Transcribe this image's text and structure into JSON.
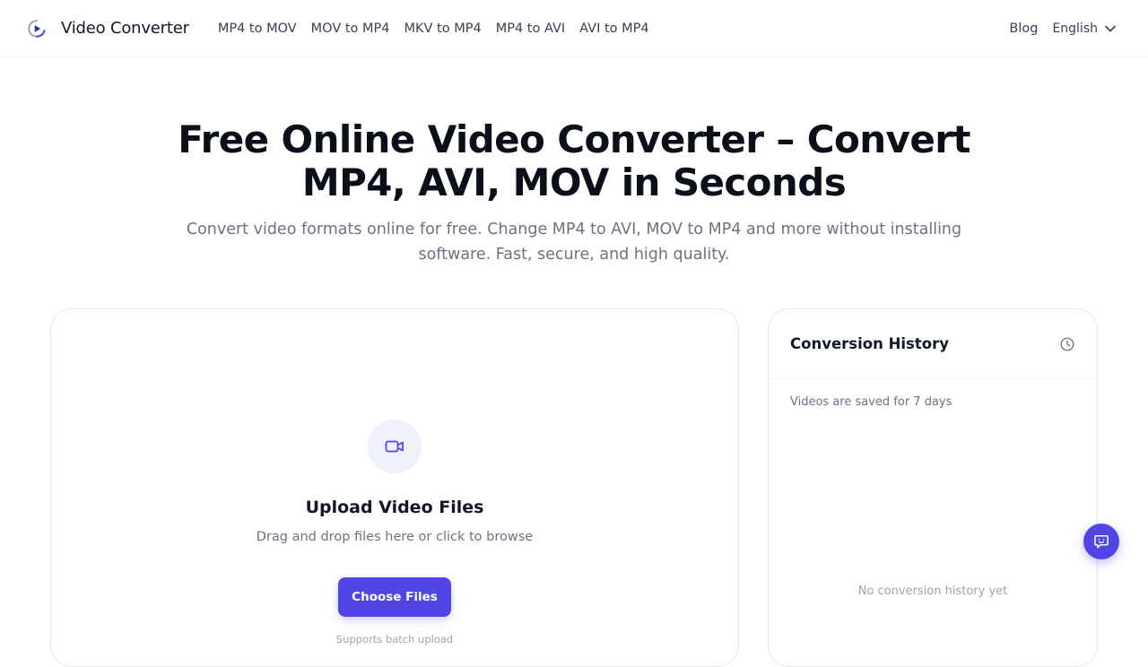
{
  "header": {
    "brand_name": "Video Converter",
    "logo_icon": "play-circle-logo-icon",
    "nav": [
      {
        "label": "MP4 to MOV"
      },
      {
        "label": "MOV to MP4"
      },
      {
        "label": "MKV to MP4"
      },
      {
        "label": "MP4 to AVI"
      },
      {
        "label": "AVI to MP4"
      }
    ],
    "blog_label": "Blog",
    "language_label": "English",
    "language_icon": "chevron-down-icon"
  },
  "hero": {
    "title_line1": "Free Online Video Converter – Convert",
    "title_line2": "MP4, AVI, MOV in Seconds",
    "subtitle_line1": "Convert video formats online for free. Change MP4 to AVI, MOV to MP4 and more without installing",
    "subtitle_line2": "software. Fast, secure, and high quality."
  },
  "upload": {
    "icon": "video-camera-icon",
    "title": "Upload Video Files",
    "description": "Drag and drop files here or click to browse",
    "button_label": "Choose Files",
    "batch_note": "Supports batch upload"
  },
  "history": {
    "title": "Conversion History",
    "icon": "clock-icon",
    "retention_note": "Videos are saved for 7 days",
    "empty_message": "No conversion history yet"
  },
  "feedback": {
    "icon": "chat-feedback-icon"
  },
  "colors": {
    "accent": "#4f46e5",
    "text_primary": "#111827",
    "text_muted": "#6b7280",
    "border": "#e5e7eb"
  }
}
